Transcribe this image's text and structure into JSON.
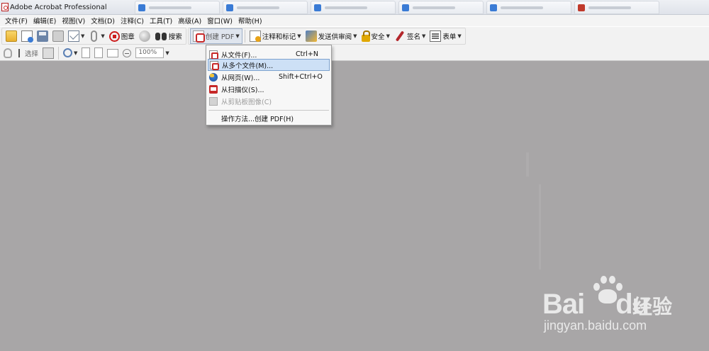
{
  "window": {
    "title": "Adobe Acrobat Professional"
  },
  "menubar": {
    "items": [
      "文件(F)",
      "编辑(E)",
      "视图(V)",
      "文档(D)",
      "注释(C)",
      "工具(T)",
      "高级(A)",
      "窗口(W)",
      "帮助(H)"
    ]
  },
  "toolbar": {
    "stamp_label": "图章",
    "search_label": "搜索",
    "create_pdf_label": "创建 PDF",
    "comment_label": "注释和标记",
    "review_label": "发送供审阅",
    "secure_label": "安全",
    "sign_label": "签名",
    "forms_label": "表单",
    "select_label": "选择",
    "zoom_value": "100%"
  },
  "create_pdf_menu": {
    "items": [
      {
        "label": "从文件(F)...",
        "shortcut": "Ctrl+N",
        "icon": "pdf-page-icon",
        "highlighted": false,
        "disabled": false
      },
      {
        "label": "从多个文件(M)...",
        "shortcut": "",
        "icon": "pdf-page-icon",
        "highlighted": true,
        "disabled": false
      },
      {
        "label": "从网页(W)...",
        "shortcut": "Shift+Ctrl+O",
        "icon": "web-icon",
        "highlighted": false,
        "disabled": false
      },
      {
        "label": "从扫描仪(S)...",
        "shortcut": "",
        "icon": "scanner-icon",
        "highlighted": false,
        "disabled": false
      },
      {
        "label": "从剪贴板图像(C)",
        "shortcut": "",
        "icon": "clipboard-icon",
        "highlighted": false,
        "disabled": true
      }
    ],
    "how_to_label": "操作方法...创建 PDF(H)"
  },
  "watermark": {
    "brand": "Bai",
    "brand_cn": "经验",
    "url": "jingyan.baidu.com"
  }
}
